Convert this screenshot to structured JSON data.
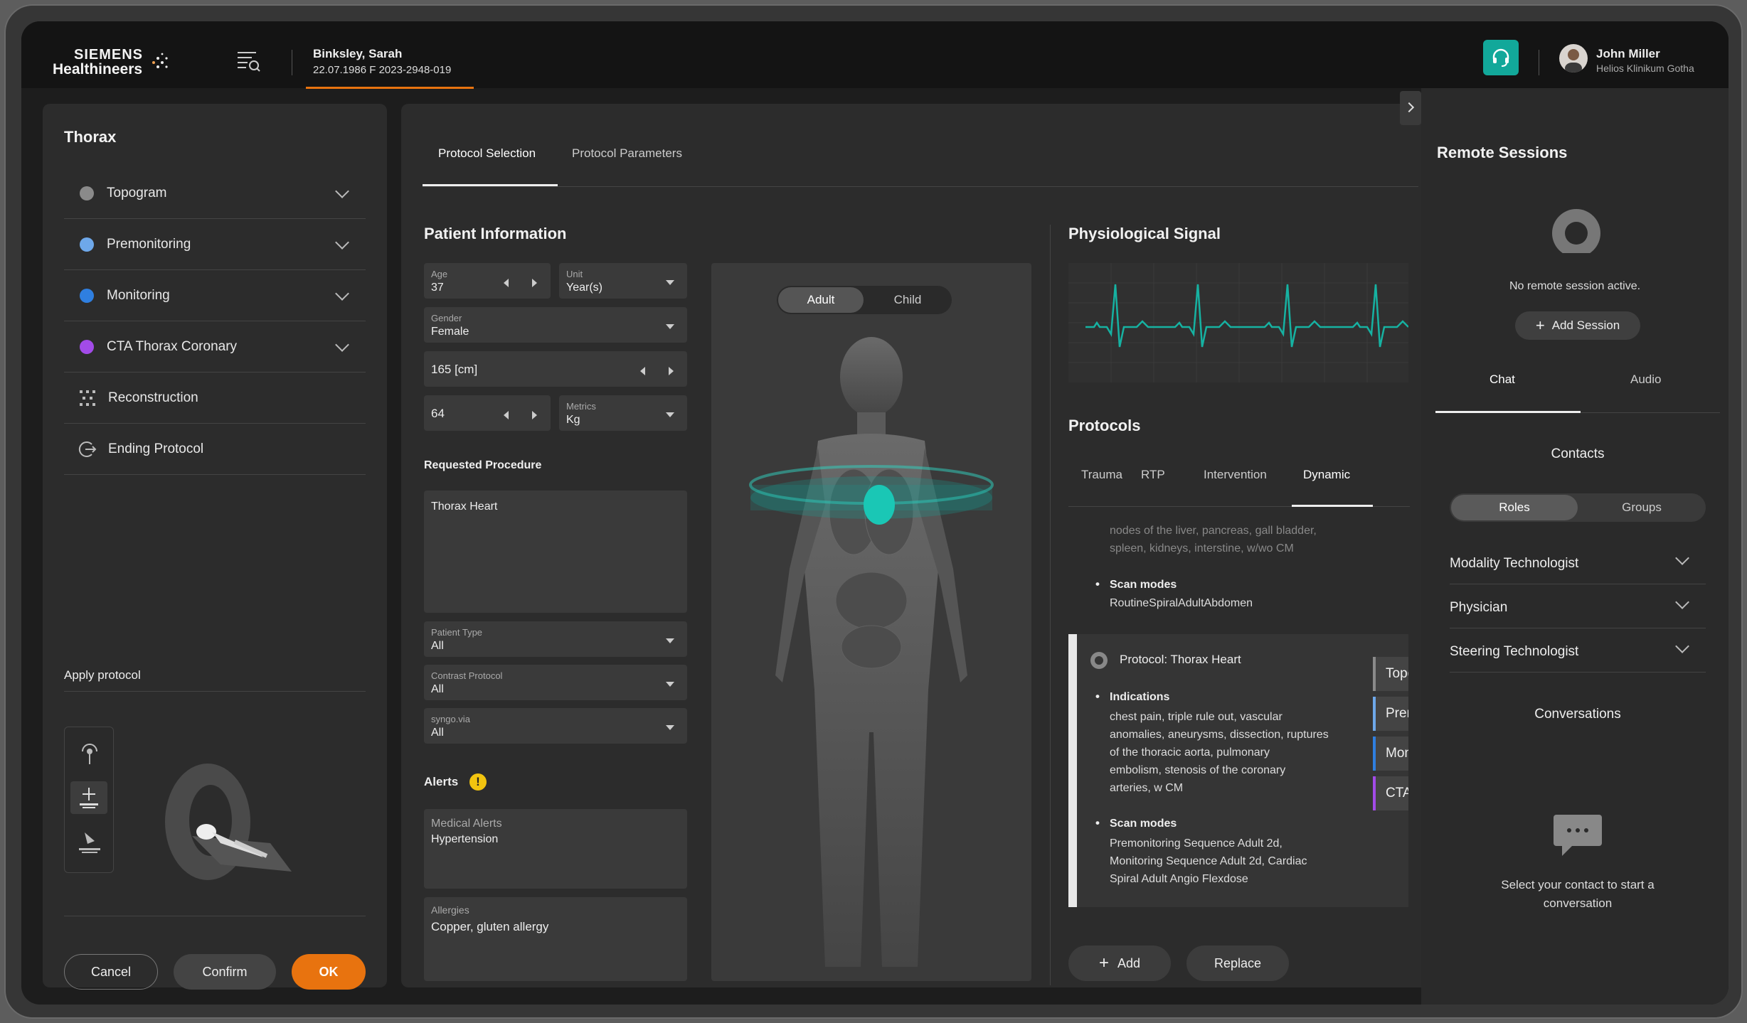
{
  "header": {
    "brand_line1": "SIEMENS",
    "brand_line2": "Healthineers",
    "patient_name": "Binksley, Sarah",
    "patient_info": "22.07.1986  F  2023-2948-019",
    "user_name": "John Miller",
    "user_org": "Helios Klinikum Gotha",
    "accent": "#e8730f",
    "headset_color": "#12a89a"
  },
  "left": {
    "title": "Thorax",
    "steps": [
      {
        "label": "Topogram",
        "color": "#8a8a8a"
      },
      {
        "label": "Premonitoring",
        "color": "#6ea8ea"
      },
      {
        "label": "Monitoring",
        "color": "#2f7fe0"
      },
      {
        "label": "CTA Thorax Coronary",
        "color": "#a24be8"
      },
      {
        "label": "Reconstruction"
      },
      {
        "label": "Ending Protocol"
      }
    ],
    "apply_label": "Apply protocol",
    "cancel": "Cancel",
    "confirm": "Confirm",
    "ok": "OK"
  },
  "center": {
    "tabs": [
      "Protocol Selection",
      "Protocol Parameters"
    ],
    "patient_info_title": "Patient Information",
    "age_label": "Age",
    "age_value": "37",
    "unit_label": "Unit",
    "unit_value": "Year(s)",
    "gender_label": "Gender",
    "gender_value": "Female",
    "height_value": "165 [cm]",
    "weight_value": "64",
    "metrics_label": "Metrics",
    "metrics_value": "Kg",
    "requested_label": "Requested Procedure",
    "requested_value": "Thorax Heart",
    "patient_type_label": "Patient Type",
    "patient_type_value": "All",
    "contrast_label": "Contrast Protocol",
    "contrast_value": "All",
    "syngo_label": "syngo.via",
    "syngo_value": "All",
    "alerts_label": "Alerts",
    "medical_alerts_label": "Medical Alerts",
    "medical_alerts_value": "Hypertension",
    "allergies_label": "Allergies",
    "allergies_value": "Copper,  gluten allergy",
    "adult": "Adult",
    "child": "Child",
    "signal_title": "Physiological Signal",
    "protocols_title": "Protocols",
    "protocol_tabs": [
      "Trauma",
      "RTP",
      "Intervention",
      "Dynamic"
    ],
    "prev_text_1": "nodes of the liver, pancreas, gall bladder,",
    "prev_text_2": "spleen, kidneys, interstine, w/wo CM",
    "prev_scan_modes": "Scan modes",
    "prev_scan_value": "RoutineSpiralAdultAbdomen",
    "card_title": "Protocol: Thorax Heart",
    "indications_label": "Indications",
    "indications_lines": [
      "chest pain, triple rule out, vascular",
      "anomalies, aneurysms, dissection, ruptures",
      "of the thoracic aorta, pulmonary",
      "embolism, stenosis of the coronary",
      "arteries, w CM"
    ],
    "scan_modes_label": "Scan modes",
    "scan_modes_lines": [
      "Premonitoring Sequence Adult 2d,",
      "Monitoring Sequence Adult 2d, Cardiac",
      "Spiral Adult Angio Flexdose"
    ],
    "side_tags": [
      {
        "label": "Topo",
        "color": "#8a8a8a"
      },
      {
        "label": "Prem",
        "color": "#6ea8ea"
      },
      {
        "label": "Moni",
        "color": "#2f7fe0"
      },
      {
        "label": "CTA T",
        "color": "#a24be8"
      }
    ],
    "add": "Add",
    "replace": "Replace"
  },
  "right": {
    "title": "Remote Sessions",
    "no_session": "No remote session active.",
    "add_session": "Add Session",
    "tabs": [
      "Chat",
      "Audio"
    ],
    "contacts": "Contacts",
    "roles": "Roles",
    "groups": "Groups",
    "role_items": [
      "Modality Technologist",
      "Physician",
      "Steering Technologist"
    ],
    "conversations": "Conversations",
    "select_line1": "Select your contact to start a",
    "select_line2": "conversation"
  }
}
